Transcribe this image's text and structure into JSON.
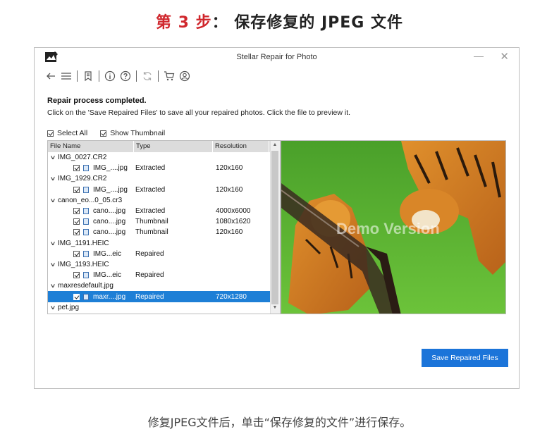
{
  "heading": {
    "step": "第 3 步",
    "rest": "： 保存修复的 JPEG 文件"
  },
  "window": {
    "title": "Stellar Repair for Photo",
    "minimize": "—",
    "close": "✕"
  },
  "toolbar": {
    "icons": [
      "back-icon",
      "menu-icon",
      "bookmark-icon",
      "info-icon",
      "help-icon",
      "refresh-icon",
      "cart-icon",
      "user-icon"
    ]
  },
  "message": {
    "title": "Repair process completed.",
    "subtitle": "Click on the 'Save Repaired Files' to save all your repaired photos. Click the file to preview it."
  },
  "options": {
    "select_all": "Select All",
    "show_thumbnail": "Show Thumbnail"
  },
  "filelist": {
    "headers": [
      "File Name",
      "Type",
      "Resolution"
    ],
    "rows": [
      {
        "kind": "group",
        "name": "IMG_0027.CR2"
      },
      {
        "kind": "file",
        "name": "IMG_....jpg",
        "type": "Extracted",
        "res": "120x160"
      },
      {
        "kind": "group",
        "name": "IMG_1929.CR2"
      },
      {
        "kind": "file",
        "name": "IMG_....jpg",
        "type": "Extracted",
        "res": "120x160"
      },
      {
        "kind": "group",
        "name": "canon_eo...0_05.cr3"
      },
      {
        "kind": "file",
        "name": "cano....jpg",
        "type": "Extracted",
        "res": "4000x6000"
      },
      {
        "kind": "file",
        "name": "cano....jpg",
        "type": "Thumbnail",
        "res": "1080x1620"
      },
      {
        "kind": "file",
        "name": "cano....jpg",
        "type": "Thumbnail",
        "res": "120x160"
      },
      {
        "kind": "group",
        "name": "IMG_1191.HEIC"
      },
      {
        "kind": "file",
        "name": "IMG...eic",
        "type": "Repaired",
        "res": ""
      },
      {
        "kind": "group",
        "name": "IMG_1193.HEIC"
      },
      {
        "kind": "file",
        "name": "IMG...eic",
        "type": "Repaired",
        "res": ""
      },
      {
        "kind": "group",
        "name": "maxresdefault.jpg"
      },
      {
        "kind": "file",
        "name": "maxr....jpg",
        "type": "Repaired",
        "res": "720x1280",
        "selected": true
      },
      {
        "kind": "group",
        "name": "pet.jpg"
      }
    ]
  },
  "preview": {
    "watermark": "Demo Version"
  },
  "save_button": "Save Repaired Files",
  "caption": "修复JPEG文件后，单击“保存修复的文件”进行保存。",
  "colors": {
    "accent": "#1b74d9",
    "heading_red": "#d0272d",
    "selection": "#1e7fd6"
  }
}
